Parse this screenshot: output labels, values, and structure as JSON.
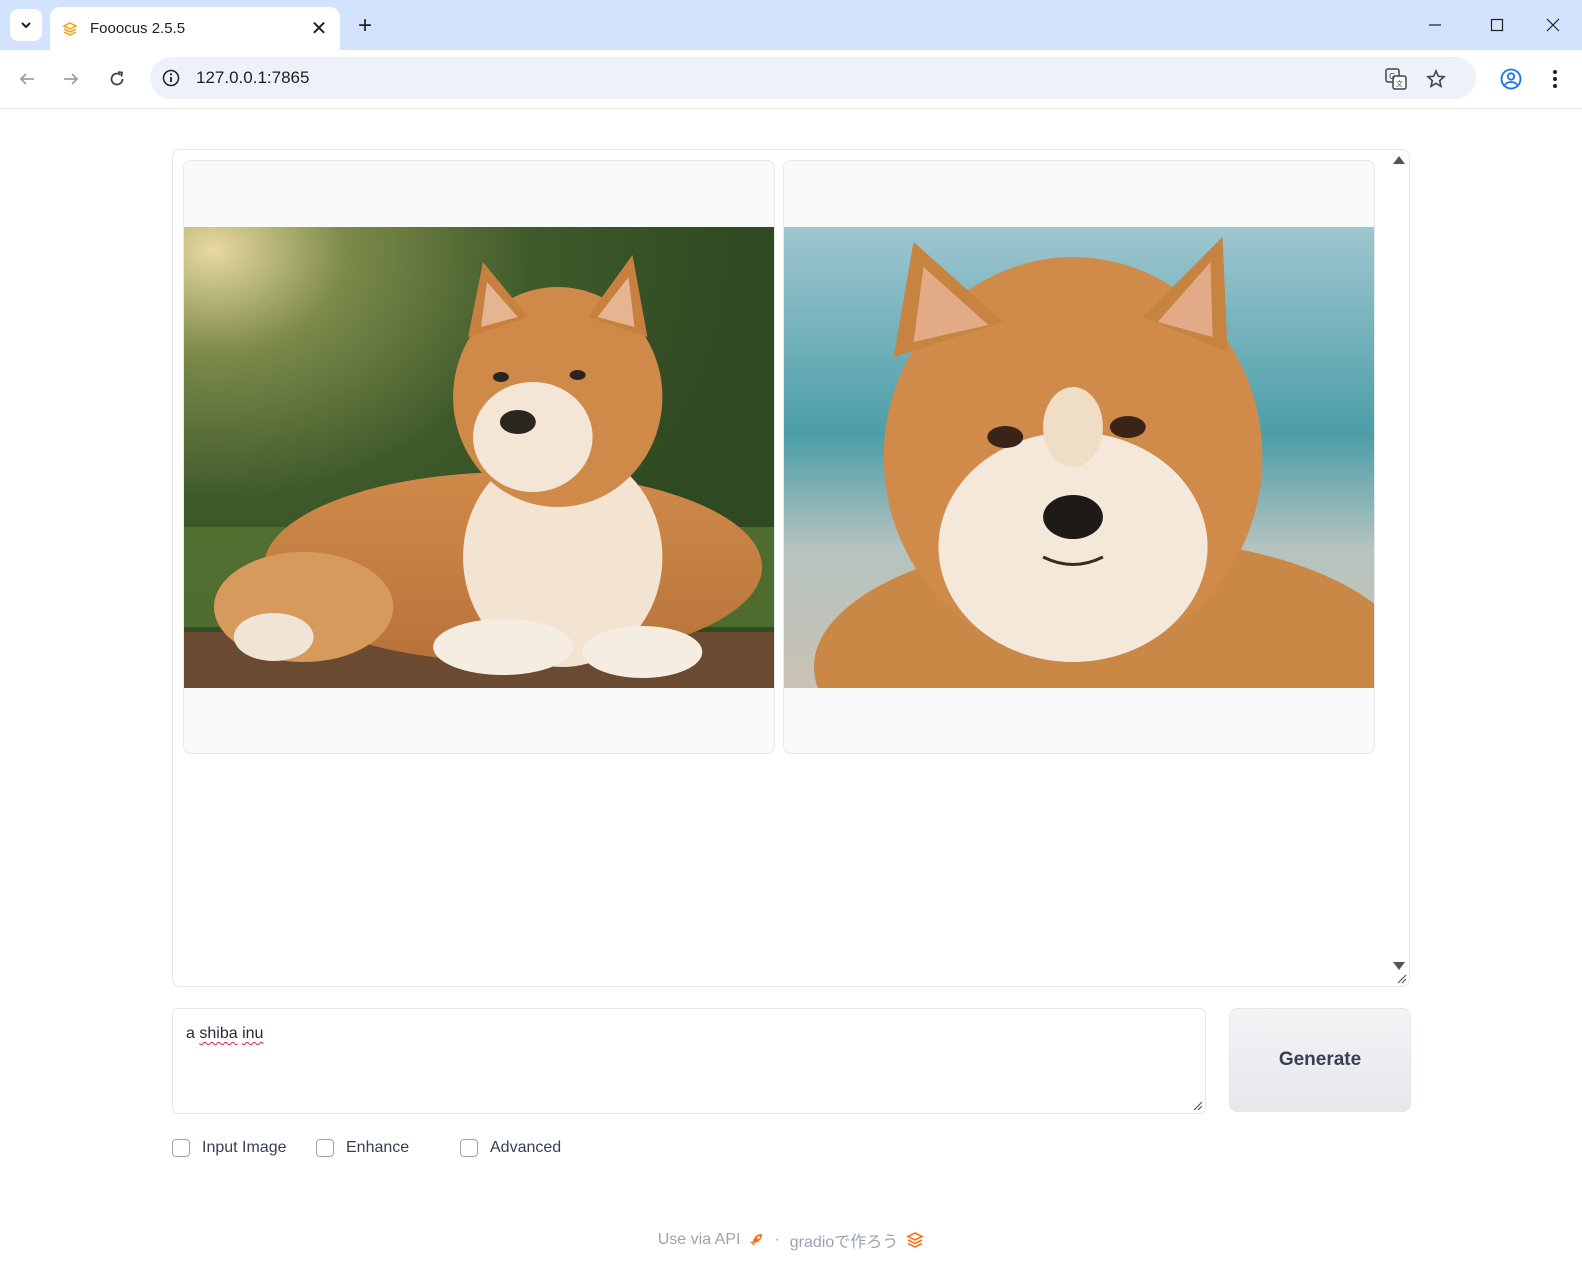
{
  "browser": {
    "tab_title": "Fooocus 2.5.5",
    "url": "127.0.0.1:7865",
    "accent": "#d3e3fd"
  },
  "gallery": {
    "items": [
      {
        "subject": "shiba inu lying on grass"
      },
      {
        "subject": "shiba inu close-up portrait"
      }
    ]
  },
  "prompt": {
    "value_word1": "a",
    "value_word2": "shiba",
    "value_word3": "inu"
  },
  "generate_label": "Generate",
  "options": [
    {
      "label": "Input Image"
    },
    {
      "label": "Enhance"
    },
    {
      "label": "Advanced"
    }
  ],
  "footer": {
    "api_label": "Use via API",
    "separator": "·",
    "gradio_label": "gradioで作ろう"
  }
}
